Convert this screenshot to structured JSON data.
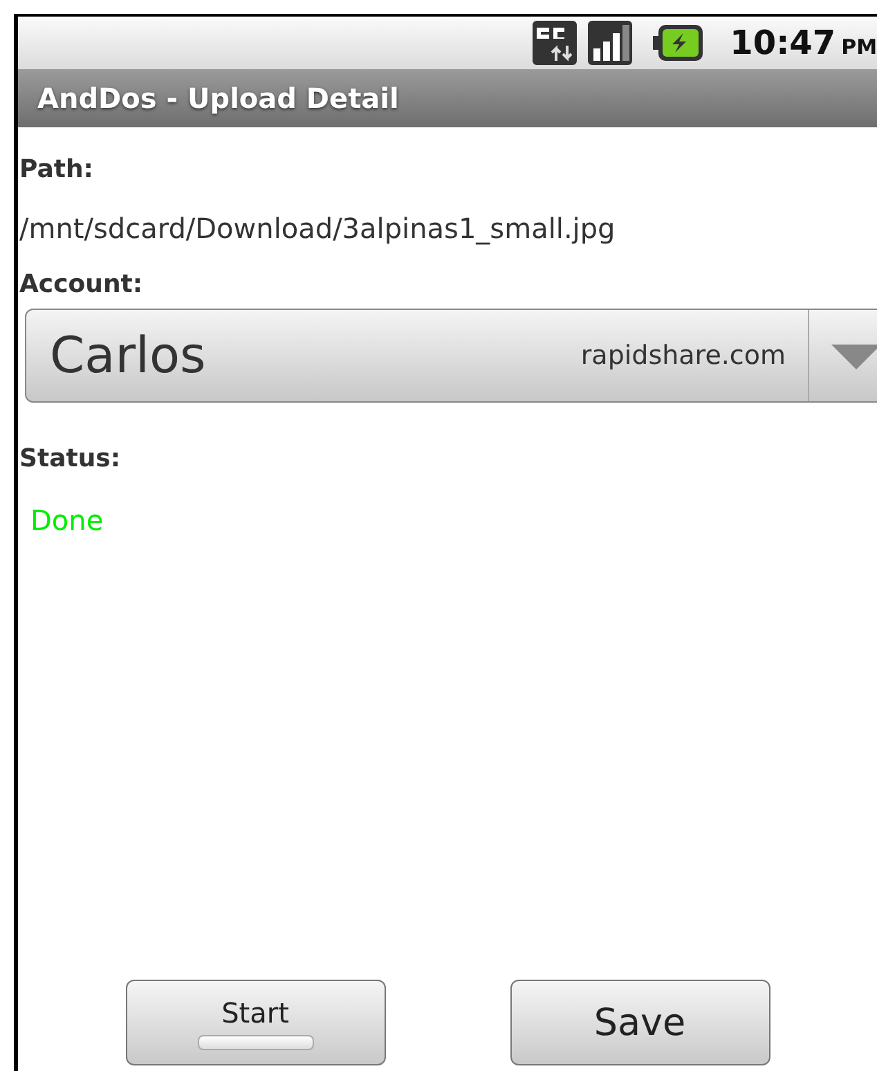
{
  "status_bar": {
    "time": "10:47",
    "ampm": "PM"
  },
  "title_bar": {
    "title": "AndDos - Upload Detail"
  },
  "path": {
    "label": "Path:",
    "value": "/mnt/sdcard/Download/3alpinas1_small.jpg"
  },
  "account": {
    "label": "Account:",
    "name": "Carlos",
    "service": "rapidshare.com"
  },
  "status": {
    "label": "Status:",
    "value": "Done",
    "color": "#00ee00"
  },
  "buttons": [
    {
      "label": "Start",
      "kind": "toggle",
      "on": false
    },
    {
      "label": "Save",
      "kind": "plain"
    }
  ]
}
